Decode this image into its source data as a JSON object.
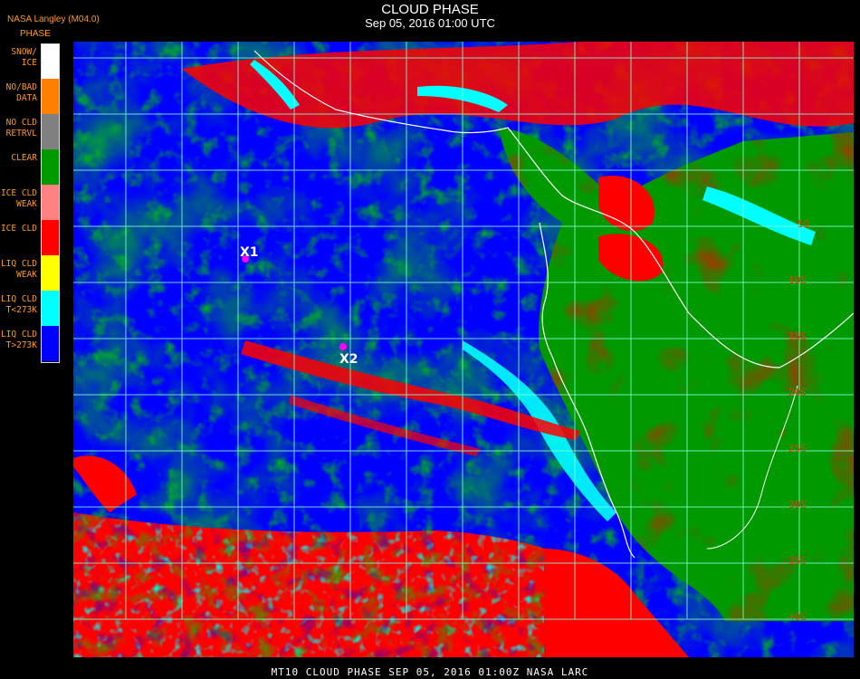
{
  "header": {
    "title": "CLOUD PHASE",
    "timestamp": "Sep 05, 2016 01:00 UTC"
  },
  "brand": "NASA Langley (M04.0)",
  "legend": {
    "title": "PHASE",
    "items": [
      {
        "label": "SNOW/\nICE",
        "color": "#ffffff"
      },
      {
        "label": "NO/BAD\nDATA",
        "color": "#ff8000"
      },
      {
        "label": "NO CLD\nRETRVL",
        "color": "#808080"
      },
      {
        "label": "CLEAR",
        "color": "#009900"
      },
      {
        "label": "ICE CLD\nWEAK",
        "color": "#ff8080"
      },
      {
        "label": "ICE CLD",
        "color": "#ff0000"
      },
      {
        "label": "LIQ CLD\nWEAK",
        "color": "#ffff00"
      },
      {
        "label": "LIQ CLD\nT<273K",
        "color": "#00ffff"
      },
      {
        "label": "LIQ CLD\nT>273K",
        "color": "#0000ff"
      }
    ]
  },
  "grid_labels": [
    "5S",
    "10S",
    "15S",
    "20S",
    "25S",
    "30S",
    "35S",
    "40S"
  ],
  "markers": [
    {
      "label": "X1",
      "color": "#ff00ff"
    },
    {
      "label": "X2",
      "color": "#ff00ff"
    }
  ],
  "footer": "MT10  CLOUD PHASE   SEP 05, 2016 01:00Z   NASA LARC"
}
